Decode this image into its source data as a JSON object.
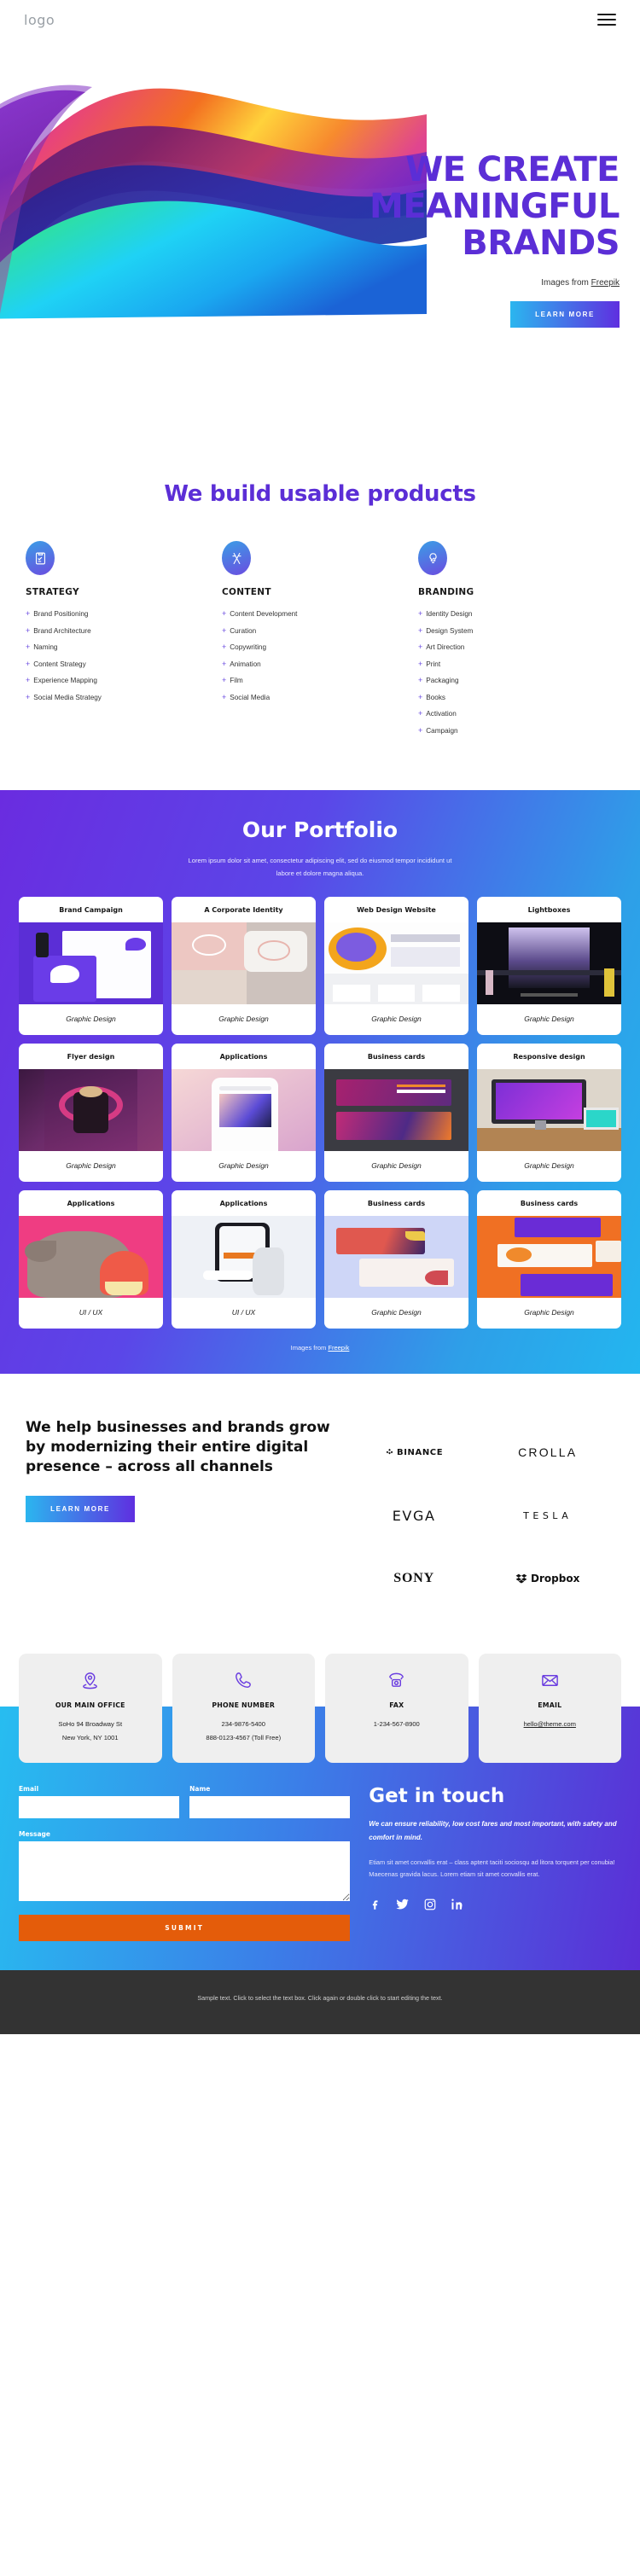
{
  "header": {
    "logo": "logo",
    "menu_icon": "hamburger-menu-icon"
  },
  "hero": {
    "title_line1": "WE CREATE",
    "title_line2": "MEANINGFUL",
    "title_line3": "BRANDS",
    "credit_prefix": "Images from ",
    "credit_link": "Freepik",
    "cta": "LEARN MORE",
    "accent": "#5b2ed6"
  },
  "services": {
    "title": "We build usable products",
    "columns": [
      {
        "icon": "clipboard-strategy-icon",
        "heading": "STRATEGY",
        "items": [
          "Brand Positioning",
          "Brand Architecture",
          "Naming",
          "Content Strategy",
          "Experience Mapping",
          "Social Media Strategy"
        ]
      },
      {
        "icon": "pen-ruler-icon",
        "heading": "CONTENT",
        "items": [
          "Content Development",
          "Curation",
          "Copywriting",
          "Animation",
          "Film",
          "Social Media"
        ]
      },
      {
        "icon": "lightbulb-idea-icon",
        "heading": "BRANDING",
        "items": [
          "Identity Design",
          "Design System",
          "Art Direction",
          "Print",
          "Packaging",
          "Books",
          "Activation",
          "Campaign"
        ]
      }
    ]
  },
  "portfolio": {
    "title": "Our Portfolio",
    "subtitle": "Lorem ipsum dolor sit amet, consectetur adipiscing elit, sed do eiusmod tempor incididunt ut labore et dolore magna aliqua.",
    "credit_prefix": "Images from ",
    "credit_link": "Freepik",
    "items": [
      {
        "title": "Brand Campaign",
        "category": "Graphic Design",
        "thumb": "th-brand"
      },
      {
        "title": "A Corporate Identity",
        "category": "Graphic Design",
        "thumb": "th-corp"
      },
      {
        "title": "Web Design Website",
        "category": "Graphic Design",
        "thumb": "th-web"
      },
      {
        "title": "Lightboxes",
        "category": "Graphic Design",
        "thumb": "th-light"
      },
      {
        "title": "Flyer design",
        "category": "Graphic Design",
        "thumb": "th-flyer"
      },
      {
        "title": "Applications",
        "category": "Graphic Design",
        "thumb": "th-apps"
      },
      {
        "title": "Business cards",
        "category": "Graphic Design",
        "thumb": "th-biz"
      },
      {
        "title": "Responsive design",
        "category": "Graphic Design",
        "thumb": "th-resp"
      },
      {
        "title": "Applications",
        "category": "UI / UX",
        "thumb": "th-cat"
      },
      {
        "title": "Applications",
        "category": "UI / UX",
        "thumb": "th-phone"
      },
      {
        "title": "Business cards",
        "category": "Graphic Design",
        "thumb": "th-biz2"
      },
      {
        "title": "Business cards",
        "category": "Graphic Design",
        "thumb": "th-biz3"
      }
    ]
  },
  "brands": {
    "heading": "We help businesses and brands grow by modernizing their entire digital presence – across all channels",
    "cta": "LEARN MORE",
    "logos": [
      {
        "name": "BINANCE",
        "icon": "binance-diamond-icon"
      },
      {
        "name": "CROLLA",
        "icon": "crolla-wordmark-icon"
      },
      {
        "name": "EVGA",
        "icon": "evga-wordmark-icon"
      },
      {
        "name": "TESLA",
        "icon": "tesla-wordmark-icon"
      },
      {
        "name": "SONY",
        "icon": "sony-wordmark-icon"
      },
      {
        "name": "Dropbox",
        "icon": "dropbox-box-icon"
      }
    ]
  },
  "contact_cards": [
    {
      "icon": "map-pin-icon",
      "title": "OUR MAIN OFFICE",
      "lines": [
        "SoHo 94 Broadway St",
        "New York, NY 1001"
      ],
      "link": false
    },
    {
      "icon": "phone-icon",
      "title": "PHONE NUMBER",
      "lines": [
        "234-9876-5400",
        "888-0123-4567 (Toll Free)"
      ],
      "link": false
    },
    {
      "icon": "fax-phone-icon",
      "title": "FAX",
      "lines": [
        "1-234-567-8900"
      ],
      "link": false
    },
    {
      "icon": "envelope-icon",
      "title": "EMAIL",
      "lines": [
        "hello@theme.com"
      ],
      "link": true
    }
  ],
  "form": {
    "email_label": "Email",
    "email_value": "",
    "email_placeholder": "",
    "name_label": "Name",
    "name_value": "",
    "name_placeholder": "",
    "message_label": "Message",
    "message_value": "",
    "message_placeholder": "",
    "submit_label": "SUBMIT",
    "submit_color": "#e45c0a"
  },
  "get_in_touch": {
    "title": "Get in touch",
    "lead": "We can ensure reliability, low cost fares and most important, with safety and comfort in mind.",
    "body": "Etiam sit amet convallis erat – class aptent taciti sociosqu ad litora torquent per conubia! Maecenas gravida lacus. Lorem etiam sit amet convallis erat.",
    "socials": [
      "facebook-icon",
      "twitter-icon",
      "instagram-icon",
      "linkedin-icon"
    ]
  },
  "footer": {
    "text": "Sample text. Click to select the text box. Click again or double click to start editing the text."
  }
}
